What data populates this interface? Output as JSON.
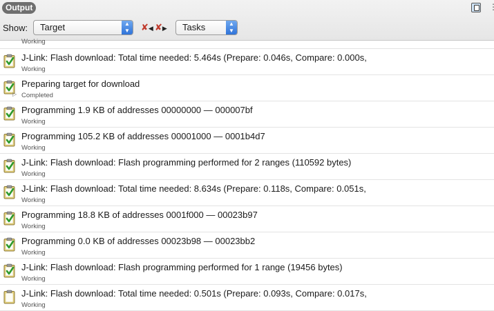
{
  "header": {
    "tab_label": "Output",
    "show_label": "Show:",
    "target_select": "Target",
    "tasks_select": "Tasks",
    "panel_icon": "panel-layout-icon",
    "more_icon": "kebab-icon"
  },
  "colors": {
    "check": "#2e9a2e",
    "clipboard": "#e9d37a",
    "select_arrow": "#2f73d9",
    "tab_bg": "#6f6f6f"
  },
  "log": {
    "partial_status": "Working",
    "rows": [
      {
        "title": "J-Link: Flash download: Total time needed: 5.464s (Prepare: 0.046s, Compare: 0.000s,",
        "status": "Working",
        "checked": true
      },
      {
        "title": "Preparing target for download",
        "status": "Completed",
        "checked": true
      },
      {
        "title": "Programming 1.9 KB of addresses 00000000 — 000007bf",
        "status": "Working",
        "checked": true
      },
      {
        "title": "Programming 105.2 KB of addresses 00001000 — 0001b4d7",
        "status": "Working",
        "checked": true
      },
      {
        "title": "J-Link: Flash download: Flash programming performed for 2 ranges (110592 bytes)",
        "status": "Working",
        "checked": true
      },
      {
        "title": "J-Link: Flash download: Total time needed: 8.634s (Prepare: 0.118s, Compare: 0.051s,",
        "status": "Working",
        "checked": true
      },
      {
        "title": "Programming 18.8 KB of addresses 0001f000 — 00023b97",
        "status": "Working",
        "checked": true
      },
      {
        "title": "Programming 0.0 KB of addresses 00023b98 — 00023bb2",
        "status": "Working",
        "checked": true
      },
      {
        "title": "J-Link: Flash download: Flash programming performed for 1 range (19456 bytes)",
        "status": "Working",
        "checked": true
      },
      {
        "title": "J-Link: Flash download: Total time needed: 0.501s (Prepare: 0.093s, Compare: 0.017s,",
        "status": "Working",
        "checked": false
      }
    ]
  }
}
